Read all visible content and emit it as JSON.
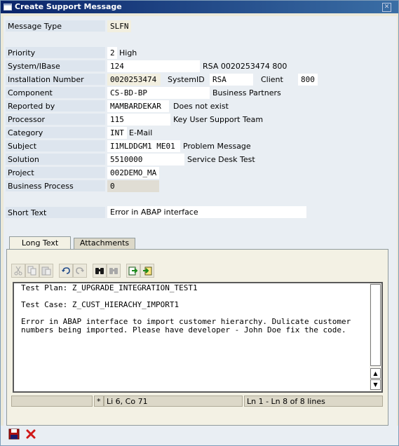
{
  "window": {
    "title": "Create Support Message"
  },
  "fields": {
    "message_type": {
      "label": "Message Type",
      "value": "SLFN"
    },
    "priority": {
      "label": "Priority",
      "value": "2",
      "desc": "High"
    },
    "system_ibase": {
      "label": "System/IBase",
      "value": "124",
      "desc": "RSA 0020253474 800"
    },
    "installation_number": {
      "label": "Installation Number",
      "value": "0020253474",
      "systemid_label": "SystemID",
      "systemid_value": "RSA",
      "client_label": "Client",
      "client_value": "800"
    },
    "component": {
      "label": "Component",
      "value": "CS-BD-BP",
      "desc": "Business Partners"
    },
    "reported_by": {
      "label": "Reported by",
      "value": "MAMBARDEKAR",
      "desc": "Does not exist"
    },
    "processor": {
      "label": "Processor",
      "value": "115",
      "desc": "Key User Support Team"
    },
    "category": {
      "label": "Category",
      "value": "INT",
      "desc": "E-Mail"
    },
    "subject": {
      "label": "Subject",
      "value": "I1MLDDGM1 ME01",
      "desc": "Problem Message"
    },
    "solution": {
      "label": "Solution",
      "value": "5510000",
      "desc": "Service Desk Test"
    },
    "project": {
      "label": "Project",
      "value": "002DEMO_MA"
    },
    "business_process": {
      "label": "Business Process",
      "value": "0"
    },
    "short_text": {
      "label": "Short Text",
      "value": "Error in ABAP interface"
    }
  },
  "tabs": [
    {
      "label": "Long Text",
      "active": true
    },
    {
      "label": "Attachments",
      "active": false
    }
  ],
  "toolbar_icons": [
    "cut-icon",
    "copy-icon",
    "paste-icon",
    "undo-icon",
    "redo-icon",
    "find-icon",
    "find-next-icon",
    "load-local-file-icon",
    "save-local-file-icon"
  ],
  "editor": {
    "lines": [
      "Test Plan: Z_UPGRADE_INTEGRATION_TEST1",
      "",
      "Test Case: Z_CUST_HIERACHY_IMPORT1",
      "",
      "Error in ABAP interface to import customer hierarchy. Dulicate customer",
      "numbers being imported. Please have developer - John Doe fix the code."
    ]
  },
  "status": {
    "segment1": "",
    "modified_marker": "*",
    "cursor_pos": "Li 6, Co 71",
    "line_info": "Ln 1 - Ln 8 of 8 lines"
  },
  "bottom_icons": [
    "save-icon",
    "cancel-icon"
  ]
}
